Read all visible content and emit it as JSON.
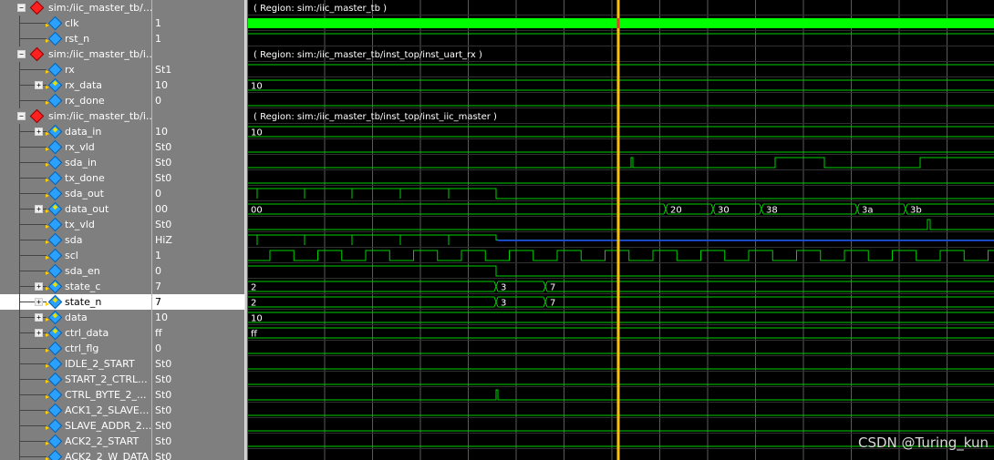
{
  "signals": [
    {
      "type": "region",
      "label": "sim:/iic_master_tb/...",
      "value": "",
      "expander": "−",
      "region": "( Region: sim:/iic_master_tb )"
    },
    {
      "type": "signal",
      "label": "clk",
      "value": "1"
    },
    {
      "type": "signal",
      "label": "rst_n",
      "value": "1"
    },
    {
      "type": "region",
      "label": "sim:/iic_master_tb/i...",
      "value": "",
      "expander": "−",
      "region": "( Region: sim:/iic_master_tb/inst_top/inst_uart_rx )"
    },
    {
      "type": "signal",
      "label": "rx",
      "value": "St1"
    },
    {
      "type": "bus",
      "label": "rx_data",
      "value": "10",
      "expander": "+"
    },
    {
      "type": "signal",
      "label": "rx_done",
      "value": "0"
    },
    {
      "type": "region",
      "label": "sim:/iic_master_tb/i...",
      "value": "",
      "expander": "−",
      "region": "( Region: sim:/iic_master_tb/inst_top/inst_iic_master )"
    },
    {
      "type": "bus",
      "label": "data_in",
      "value": "10",
      "expander": "+"
    },
    {
      "type": "signal",
      "label": "rx_vld",
      "value": "St0"
    },
    {
      "type": "signal",
      "label": "sda_in",
      "value": "St0"
    },
    {
      "type": "signal",
      "label": "tx_done",
      "value": "St0"
    },
    {
      "type": "signal",
      "label": "sda_out",
      "value": "0"
    },
    {
      "type": "bus",
      "label": "data_out",
      "value": "00",
      "expander": "+"
    },
    {
      "type": "signal",
      "label": "tx_vld",
      "value": "St0"
    },
    {
      "type": "signal",
      "label": "sda",
      "value": "HiZ"
    },
    {
      "type": "signal",
      "label": "scl",
      "value": "1"
    },
    {
      "type": "signal",
      "label": "sda_en",
      "value": "0"
    },
    {
      "type": "bus",
      "label": "state_c",
      "value": "7",
      "expander": "+"
    },
    {
      "type": "bus",
      "label": "state_n",
      "value": "7",
      "expander": "+",
      "selected": true
    },
    {
      "type": "bus",
      "label": "data",
      "value": "10",
      "expander": "+"
    },
    {
      "type": "bus",
      "label": "ctrl_data",
      "value": "ff",
      "expander": "+"
    },
    {
      "type": "signal",
      "label": "ctrl_flg",
      "value": "0"
    },
    {
      "type": "signal",
      "label": "IDLE_2_START",
      "value": "St0"
    },
    {
      "type": "signal",
      "label": "START_2_CTRL...",
      "value": "St0"
    },
    {
      "type": "signal",
      "label": "CTRL_BYTE_2_...",
      "value": "St0"
    },
    {
      "type": "signal",
      "label": "ACK1_2_SLAVE...",
      "value": "St0"
    },
    {
      "type": "signal",
      "label": "SLAVE_ADDR_2...",
      "value": "St0"
    },
    {
      "type": "signal",
      "label": "ACK2_2_START",
      "value": "St0"
    },
    {
      "type": "signal",
      "label": "ACK2_2_W_DATA",
      "value": "St0"
    }
  ],
  "bus_labels": {
    "rx_data": [
      "10"
    ],
    "data_in": [
      "10"
    ],
    "data_out": [
      "00",
      "20",
      "30",
      "38",
      "3a",
      "3b"
    ],
    "state_c": [
      "2",
      "3",
      "7"
    ],
    "state_n": [
      "2",
      "3",
      "7"
    ],
    "data": [
      "10"
    ],
    "ctrl_data": [
      "ff"
    ]
  },
  "colors": {
    "wave": "#00d000",
    "clk_fill": "#00ff00",
    "cursor": "#ffc000",
    "hiz": "#2040ff",
    "grid": "#5a5a5a"
  },
  "watermark": "CSDN @Turing_kun"
}
